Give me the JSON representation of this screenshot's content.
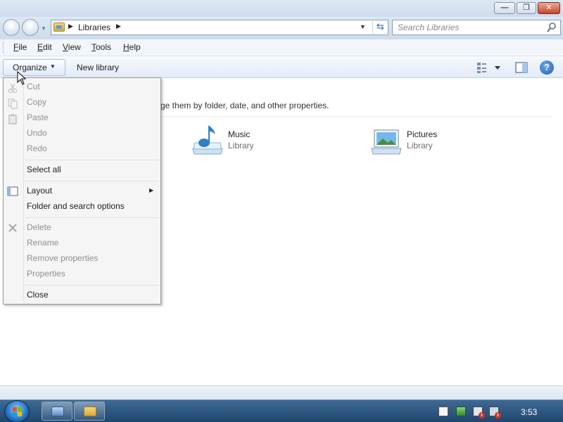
{
  "window": {
    "minimize_glyph": "—",
    "maximize_glyph": "❐",
    "close_glyph": "✕"
  },
  "address_bar": {
    "breadcrumb": "Libraries",
    "search_placeholder": "Search Libraries"
  },
  "menu_bar": {
    "items": [
      {
        "accel": "F",
        "rest": "ile"
      },
      {
        "accel": "E",
        "rest": "dit"
      },
      {
        "accel": "V",
        "rest": "iew"
      },
      {
        "accel": "T",
        "rest": "ools"
      },
      {
        "accel": "H",
        "rest": "elp"
      }
    ]
  },
  "toolbar": {
    "organize_label": "Organize",
    "new_library_label": "New library",
    "help_glyph": "?"
  },
  "content": {
    "description": "ge them by folder, date, and other properties.",
    "libraries": [
      {
        "name": "Music",
        "type": "Library",
        "icon": "music-library-icon"
      },
      {
        "name": "Pictures",
        "type": "Library",
        "icon": "pictures-library-icon"
      }
    ]
  },
  "organize_menu": {
    "items": [
      {
        "label": "Cut",
        "enabled": false
      },
      {
        "label": "Copy",
        "enabled": false
      },
      {
        "label": "Paste",
        "enabled": false
      },
      {
        "label": "Undo",
        "enabled": false
      },
      {
        "label": "Redo",
        "enabled": false
      },
      {
        "label": "Select all",
        "enabled": true
      },
      {
        "label": "Layout",
        "enabled": true,
        "submenu": true
      },
      {
        "label": "Folder and search options",
        "enabled": true
      },
      {
        "label": "Delete",
        "enabled": false
      },
      {
        "label": "Rename",
        "enabled": false
      },
      {
        "label": "Remove properties",
        "enabled": false
      },
      {
        "label": "Properties",
        "enabled": false
      },
      {
        "label": "Close",
        "enabled": true
      }
    ]
  },
  "taskbar": {
    "clock": "3:53"
  },
  "colors": {
    "accent": "#1f5fb8",
    "disabled_text": "#8f8f8f"
  }
}
